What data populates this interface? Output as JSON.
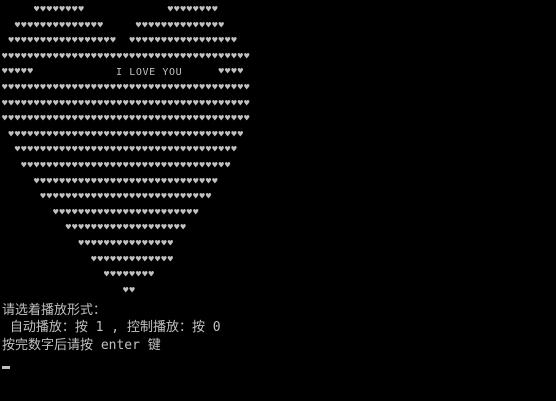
{
  "console": {
    "background": "#000000",
    "text_color": "#c0c0c0",
    "heart_glyph": "♥",
    "heart_lines": [
      "     ♥♥♥♥♥♥♥♥             ♥♥♥♥♥♥♥♥",
      "  ♥♥♥♥♥♥♥♥♥♥♥♥♥♥     ♥♥♥♥♥♥♥♥♥♥♥♥♥♥",
      " ♥♥♥♥♥♥♥♥♥♥♥♥♥♥♥♥♥  ♥♥♥♥♥♥♥♥♥♥♥♥♥♥♥♥♥",
      "♥♥♥♥♥♥♥♥♥♥♥♥♥♥♥♥♥♥♥♥♥♥♥♥♥♥♥♥♥♥♥♥♥♥♥♥♥♥♥",
      "♥♥♥♥♥                             ♥♥♥♥",
      "♥♥♥♥♥♥♥♥♥♥♥♥♥♥♥♥♥♥♥♥♥♥♥♥♥♥♥♥♥♥♥♥♥♥♥♥♥♥♥",
      "♥♥♥♥♥♥♥♥♥♥♥♥♥♥♥♥♥♥♥♥♥♥♥♥♥♥♥♥♥♥♥♥♥♥♥♥♥♥♥",
      "♥♥♥♥♥♥♥♥♥♥♥♥♥♥♥♥♥♥♥♥♥♥♥♥♥♥♥♥♥♥♥♥♥♥♥♥♥♥♥",
      " ♥♥♥♥♥♥♥♥♥♥♥♥♥♥♥♥♥♥♥♥♥♥♥♥♥♥♥♥♥♥♥♥♥♥♥♥♥",
      "  ♥♥♥♥♥♥♥♥♥♥♥♥♥♥♥♥♥♥♥♥♥♥♥♥♥♥♥♥♥♥♥♥♥♥♥",
      "   ♥♥♥♥♥♥♥♥♥♥♥♥♥♥♥♥♥♥♥♥♥♥♥♥♥♥♥♥♥♥♥♥♥",
      "     ♥♥♥♥♥♥♥♥♥♥♥♥♥♥♥♥♥♥♥♥♥♥♥♥♥♥♥♥♥",
      "      ♥♥♥♥♥♥♥♥♥♥♥♥♥♥♥♥♥♥♥♥♥♥♥♥♥♥♥",
      "        ♥♥♥♥♥♥♥♥♥♥♥♥♥♥♥♥♥♥♥♥♥♥♥",
      "          ♥♥♥♥♥♥♥♥♥♥♥♥♥♥♥♥♥♥♥",
      "            ♥♥♥♥♥♥♥♥♥♥♥♥♥♥♥",
      "              ♥♥♥♥♥♥♥♥♥♥♥♥♥",
      "                ♥♥♥♥♥♥♥♥",
      "                   ♥♥"
    ],
    "love_text": "I LOVE YOU",
    "prompt_line1": "请选着播放形式：",
    "prompt_line2": " 自动播放：按 1 , 控制播放：按 0",
    "prompt_line3": "按完数字后请按 enter 键"
  }
}
